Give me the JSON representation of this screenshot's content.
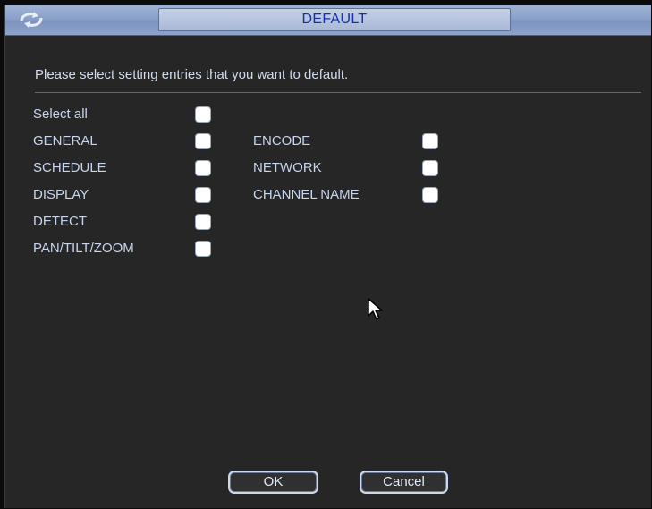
{
  "dialog": {
    "title": "DEFAULT",
    "instruction": "Please select setting entries that you want to default.",
    "select_all_label": "Select all",
    "left_entries": [
      {
        "label": "GENERAL",
        "checked": false
      },
      {
        "label": "SCHEDULE",
        "checked": false
      },
      {
        "label": "DISPLAY",
        "checked": false
      },
      {
        "label": "DETECT",
        "checked": false
      },
      {
        "label": "PAN/TILT/ZOOM",
        "checked": false
      }
    ],
    "right_entries": [
      {
        "label": "ENCODE",
        "checked": false
      },
      {
        "label": "NETWORK",
        "checked": false
      },
      {
        "label": "CHANNEL NAME",
        "checked": false
      }
    ],
    "ok_label": "OK",
    "cancel_label": "Cancel"
  },
  "colors": {
    "title_bar": "#8aa0c8",
    "title_text": "#1530a6",
    "background": "#262626",
    "text": "#c8d5ee",
    "divider": "#4f6a9c"
  }
}
